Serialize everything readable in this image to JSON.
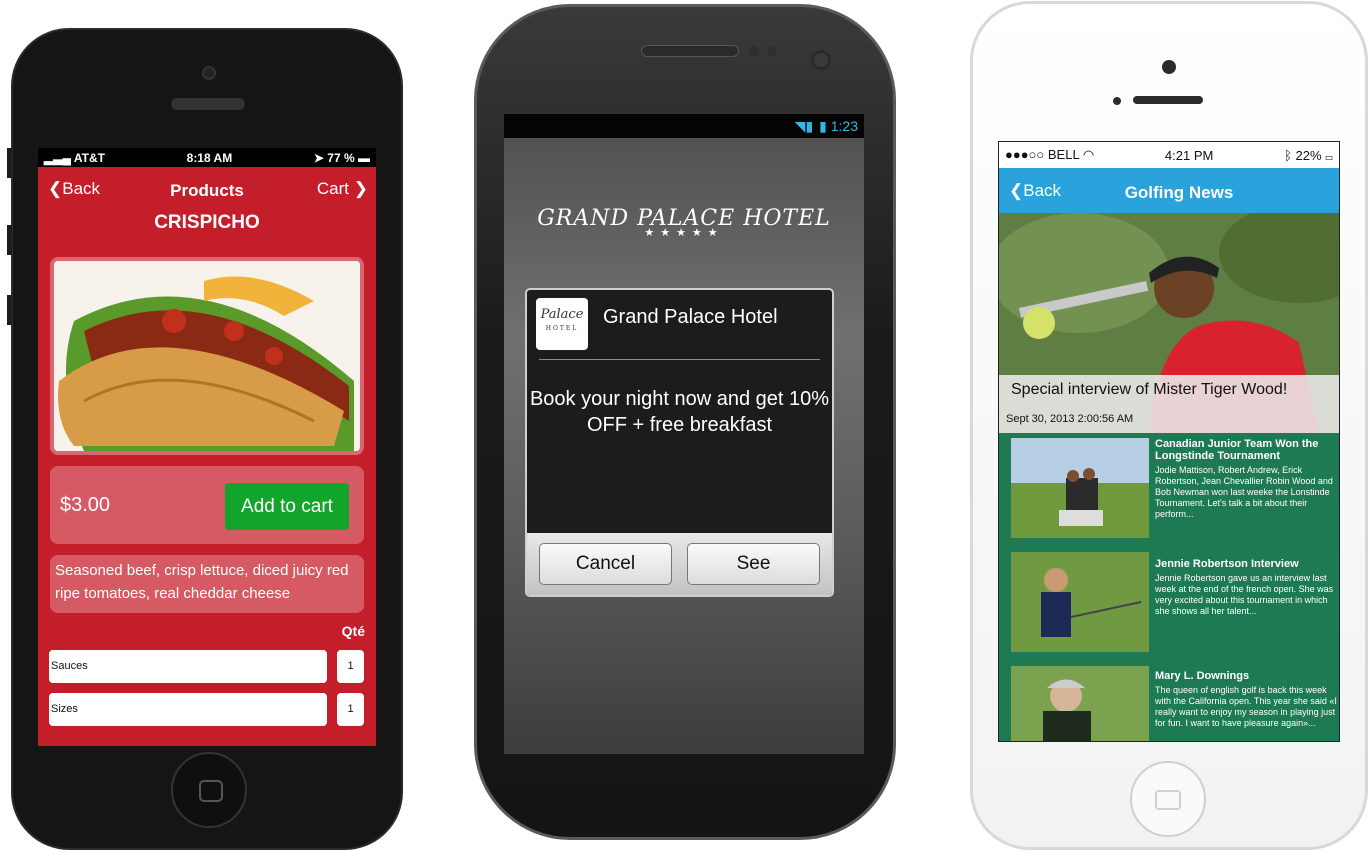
{
  "phone1": {
    "status": {
      "carrier": "AT&T",
      "time": "8:18 AM",
      "battery": "77 %"
    },
    "nav": {
      "back": "Back",
      "title": "Products",
      "cart": "Cart"
    },
    "product": {
      "name": "CRISPICHO",
      "price": "$3.00",
      "add_to_cart": "Add to cart",
      "description": "Seasoned beef, crisp lettuce, diced juicy red ripe tomatoes, real cheddar cheese",
      "qty_header": "Qté",
      "options": [
        {
          "label": "Sauces",
          "qty": "1"
        },
        {
          "label": "Sizes",
          "qty": "1"
        }
      ]
    }
  },
  "phone2": {
    "status": {
      "time": "1:23"
    },
    "hotel_title": "GRAND PALACE HOTEL",
    "stars": "★★★★★",
    "dialog": {
      "logo_text": "Palace",
      "logo_sub": "HOTEL",
      "title": "Grand Palace Hotel",
      "message": "Book your night now and get 10% OFF + free breakfast",
      "cancel": "Cancel",
      "see": "See"
    }
  },
  "phone3": {
    "status": {
      "carrier": "BELL",
      "time": "4:21 PM",
      "battery": "22%"
    },
    "nav": {
      "back": "Back",
      "title": "Golfing News"
    },
    "hero": {
      "title": "Special interview of Mister Tiger Wood!",
      "date": "Sept 30, 2013 2:00:56 AM"
    },
    "items": [
      {
        "title": "Canadian Junior Team Won the Longstinde Tournament",
        "body": "Jodie Mattison, Robert Andrew, Erick Robertson, Jean Chevallier Robin Wood and Bob Newman won last weeke the Lonstinde Tournament. Let's talk a bit about their perform..."
      },
      {
        "title": "Jennie Robertson Interview",
        "body": "Jennie Robertson gave us an interview last week at the end of the french open. She was very excited about this tournament in which she shows all her talent..."
      },
      {
        "title": "Mary L. Downings",
        "body": "The queen of english golf is back this week with the California open. This year she said «I really want to enjoy my season in playing just for fun. I want to have pleasure again»..."
      }
    ]
  }
}
